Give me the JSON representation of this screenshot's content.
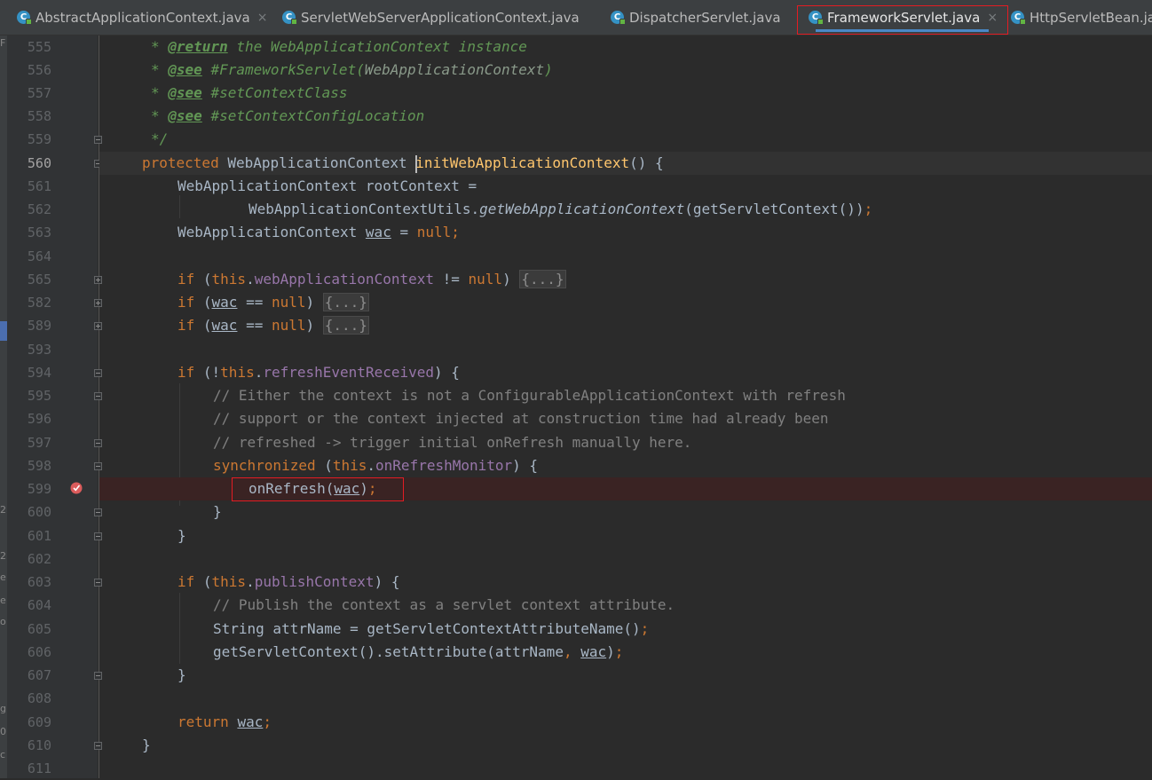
{
  "tabs": [
    {
      "label": "AbstractApplicationContext.java",
      "icon": "class-icon",
      "close": "×",
      "active": false
    },
    {
      "label": "ServletWebServerApplicationContext.java",
      "icon": "class-icon",
      "close": "×",
      "active": false
    },
    {
      "label": "DispatcherServlet.java",
      "icon": "class-icon",
      "close": "×",
      "active": false
    },
    {
      "label": "FrameworkServlet.java",
      "icon": "class-icon",
      "close": "×",
      "active": true
    },
    {
      "label": "HttpServletBean.ja",
      "icon": "class-icon",
      "close": "",
      "active": false
    }
  ],
  "icon_glyph": "C",
  "left_strip": [
    "F",
    "2",
    "2",
    "e",
    "e",
    "o",
    "g",
    "0.",
    "c"
  ],
  "gutter": {
    "line_numbers": [
      "555",
      "556",
      "557",
      "558",
      "559",
      "560",
      "561",
      "562",
      "563",
      "564",
      "565",
      "582",
      "589",
      "593",
      "594",
      "595",
      "596",
      "597",
      "598",
      "599",
      "600",
      "601",
      "602",
      "603",
      "604",
      "605",
      "606",
      "607",
      "608",
      "609",
      "610",
      "611"
    ],
    "current_line": "560",
    "breakpoint_line": "599"
  },
  "code": {
    "l555": {
      "star": "* ",
      "tag": "@return",
      "text": " the WebApplicationContext instance"
    },
    "l556": {
      "star": "* ",
      "tag": "@see",
      "sp": " ",
      "ref": "#FrameworkServlet(",
      "type": "WebApplicationContext",
      "close": ")"
    },
    "l557": {
      "star": "* ",
      "tag": "@see",
      "sp": " ",
      "ref": "#setContextClass"
    },
    "l558": {
      "star": "* ",
      "tag": "@see",
      "sp": " ",
      "ref": "#setContextConfigLocation"
    },
    "l559": {
      "end": "*/"
    },
    "l560": {
      "kw": "protected",
      "type": " WebApplicationContext ",
      "method": "initWebApplicationContext",
      "rest": "() {"
    },
    "l561": {
      "text": "WebApplicationContext rootContext ="
    },
    "l562": {
      "cls": "WebApplicationContextUtils.",
      "call": "getWebApplicationContext",
      "args": "(getServletContext())",
      "semi": ";"
    },
    "l563": {
      "type": "WebApplicationContext ",
      "var": "wac",
      "eq": " = ",
      "nul": "null",
      "semi": ";"
    },
    "l565": {
      "kw": "if",
      "open": " (",
      "this": "this",
      "dot": ".",
      "field": "webApplicationContext",
      "op": " != ",
      "nul": "null",
      "close": ") ",
      "fold": "{...}"
    },
    "l582": {
      "kw": "if",
      "open": " (",
      "var": "wac",
      "op": " == ",
      "nul": "null",
      "close": ") ",
      "fold": "{...}"
    },
    "l589": {
      "kw": "if",
      "open": " (",
      "var": "wac",
      "op": " == ",
      "nul": "null",
      "close": ") ",
      "fold": "{...}"
    },
    "l594": {
      "kw": "if",
      "open": " (!",
      "this": "this",
      "dot": ".",
      "field": "refreshEventReceived",
      "close": ") {"
    },
    "l595": {
      "comment": "// Either the context is not a ConfigurableApplicationContext with refresh"
    },
    "l596": {
      "comment": "// support or the context injected at construction time had already been"
    },
    "l597": {
      "comment": "// refreshed -> trigger initial onRefresh manually here."
    },
    "l598": {
      "kw": "synchronized",
      "open": " (",
      "this": "this",
      "dot": ".",
      "field": "onRefreshMonitor",
      "close": ") {"
    },
    "l599": {
      "call": "onRefresh(",
      "var": "wac",
      "close": ")",
      "semi": ";"
    },
    "l600": {
      "text": "}"
    },
    "l601": {
      "text": "}"
    },
    "l603": {
      "kw": "if",
      "open": " (",
      "this": "this",
      "dot": ".",
      "field": "publishContext",
      "close": ") {"
    },
    "l604": {
      "comment": "// Publish the context as a servlet context attribute."
    },
    "l605": {
      "text": "String attrName = getServletContextAttributeName()",
      "semi": ";"
    },
    "l606": {
      "text": "getServletContext().setAttribute(attrName",
      "comma": ", ",
      "var": "wac",
      "close": ")",
      "semi": ";"
    },
    "l607": {
      "text": "}"
    },
    "l609": {
      "kw": "return",
      "sp": " ",
      "var": "wac",
      "semi": ";"
    },
    "l610": {
      "text": "}"
    }
  }
}
